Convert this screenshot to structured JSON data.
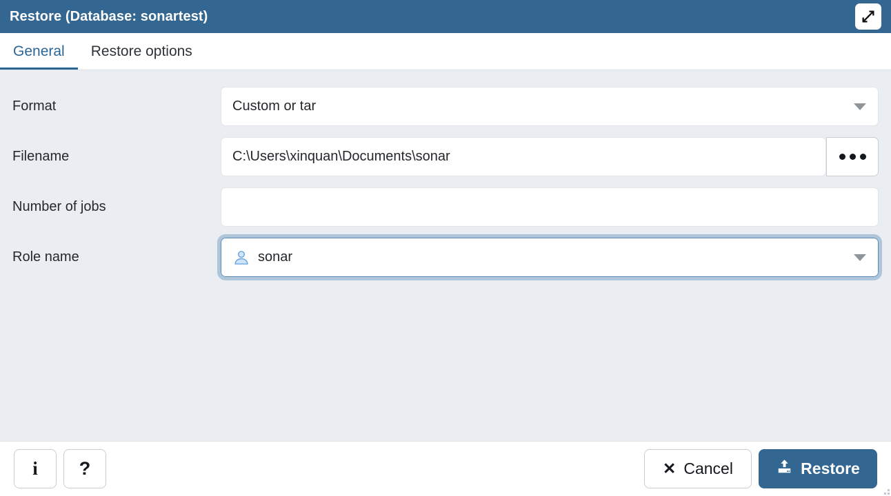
{
  "titlebar": {
    "title": "Restore (Database: sonartest)",
    "maximize_icon": "expand-arrows-icon"
  },
  "tabs": [
    {
      "label": "General",
      "active": true
    },
    {
      "label": "Restore options",
      "active": false
    }
  ],
  "form": {
    "fields": [
      {
        "label": "Format",
        "type": "select",
        "value": "Custom or tar",
        "placeholder": "",
        "icon": "chevron-down-icon"
      },
      {
        "label": "Filename",
        "type": "text-with-browse",
        "value": "C:\\Users\\xinquan\\Documents\\sonar",
        "placeholder": "",
        "browse_label": "•••"
      },
      {
        "label": "Number of jobs",
        "type": "text",
        "value": "",
        "placeholder": ""
      },
      {
        "label": "Role name",
        "type": "select",
        "value": "sonar",
        "placeholder": "",
        "icon": "user-icon",
        "focused": true
      }
    ]
  },
  "footer": {
    "info_label": "i",
    "help_label": "?",
    "cancel_label": "Cancel",
    "cancel_icon": "close-x-icon",
    "restore_label": "Restore",
    "restore_icon": "upload-icon"
  },
  "colors": {
    "titlebar_bg": "#336690",
    "accent": "#2b6596",
    "body_bg": "#eaeef2",
    "footer_bg": "#ffffff",
    "primary_button_bg": "#336690",
    "focus_ring": "#afc6da",
    "user_icon": "#a8cdf0"
  }
}
